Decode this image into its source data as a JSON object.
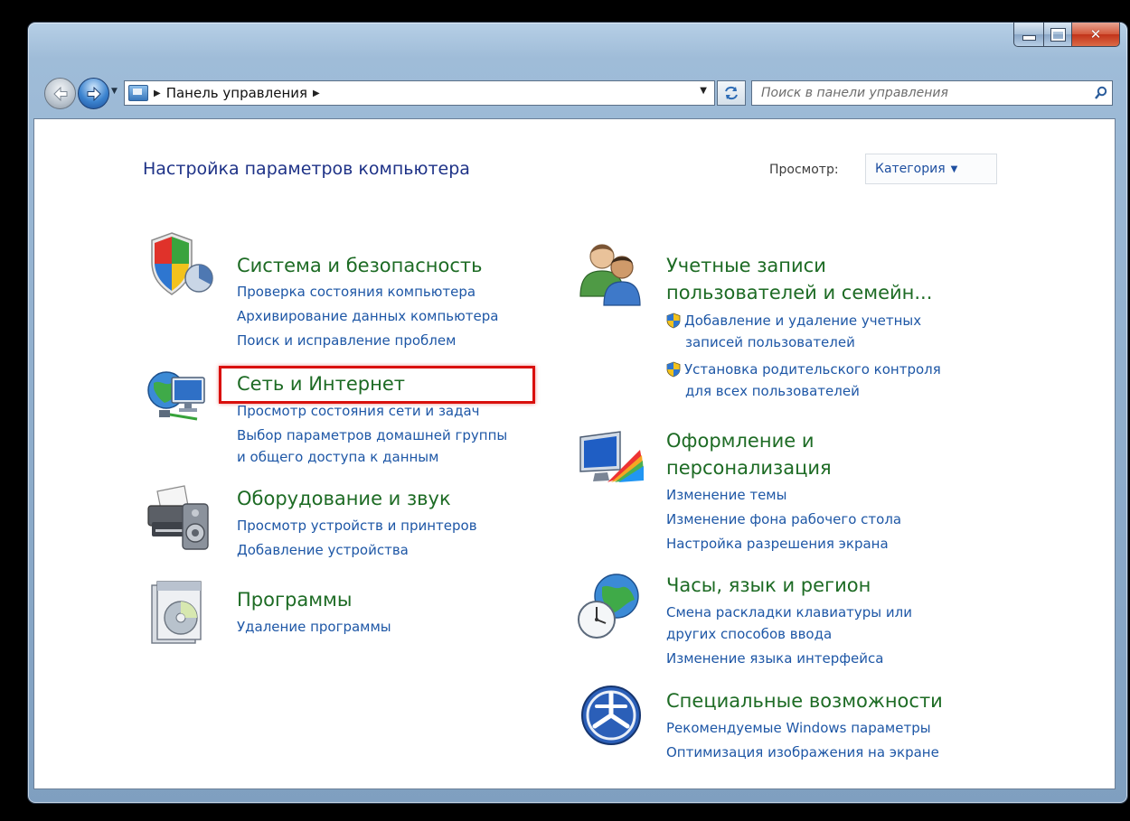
{
  "window": {
    "buttons": {
      "minimize": "minimize-icon",
      "maximize": "maximize-icon",
      "close": "close-icon"
    },
    "close_glyph": "✕"
  },
  "navbar": {
    "breadcrumb": "Панель управления",
    "separator": "▶",
    "search_placeholder": "Поиск в панели управления",
    "icons": [
      "back-arrow-icon",
      "forward-arrow-icon",
      "control-panel-icon",
      "refresh-icon",
      "search-icon"
    ]
  },
  "header": {
    "title": "Настройка параметров компьютера",
    "view_label": "Просмотр:",
    "view_value": "Категория",
    "view_arrow": "▼"
  },
  "colors": {
    "category_title": "#1d6b24",
    "link": "#1e57a6",
    "page_title": "#1e3287",
    "highlight": "#d9100d"
  },
  "left_categories": [
    {
      "title": "Система и безопасность",
      "icon": "shield-icon",
      "links": [
        "Проверка состояния компьютера",
        "Архивирование данных компьютера",
        "Поиск и исправление проблем"
      ]
    },
    {
      "title": "Сеть и Интернет",
      "icon": "network-globe-icon",
      "highlighted": true,
      "links": [
        "Просмотр состояния сети и задач",
        "Выбор параметров домашней группы",
        "и общего доступа к данным"
      ]
    },
    {
      "title": "Оборудование и звук",
      "icon": "printer-speaker-icon",
      "links": [
        "Просмотр устройств и принтеров",
        "Добавление устройства"
      ]
    },
    {
      "title": "Программы",
      "icon": "programs-disc-icon",
      "links": [
        "Удаление программы"
      ]
    }
  ],
  "right_categories": [
    {
      "title_line1": "Учетные записи",
      "title_line2": "пользователей и семейн...",
      "icon": "users-icon",
      "links": [
        {
          "line1": "Добавление и удаление учетных",
          "line2": "записей пользователей",
          "shield": true
        },
        {
          "line1": "Установка родительского контроля",
          "line2": "для всех пользователей",
          "shield": true
        }
      ]
    },
    {
      "title_line1": "Оформление и",
      "title_line2": "персонализация",
      "icon": "monitor-palette-icon",
      "links": [
        "Изменение темы",
        "Изменение фона рабочего стола",
        "Настройка разрешения экрана"
      ]
    },
    {
      "title": "Часы, язык и регион",
      "icon": "clock-globe-icon",
      "links": [
        "Смена раскладки клавиатуры или",
        "других способов ввода",
        "Изменение языка интерфейса"
      ]
    },
    {
      "title": "Специальные возможности",
      "icon": "accessibility-icon",
      "links": [
        "Рекомендуемые Windows параметры",
        "Оптимизация изображения на экране"
      ]
    }
  ]
}
